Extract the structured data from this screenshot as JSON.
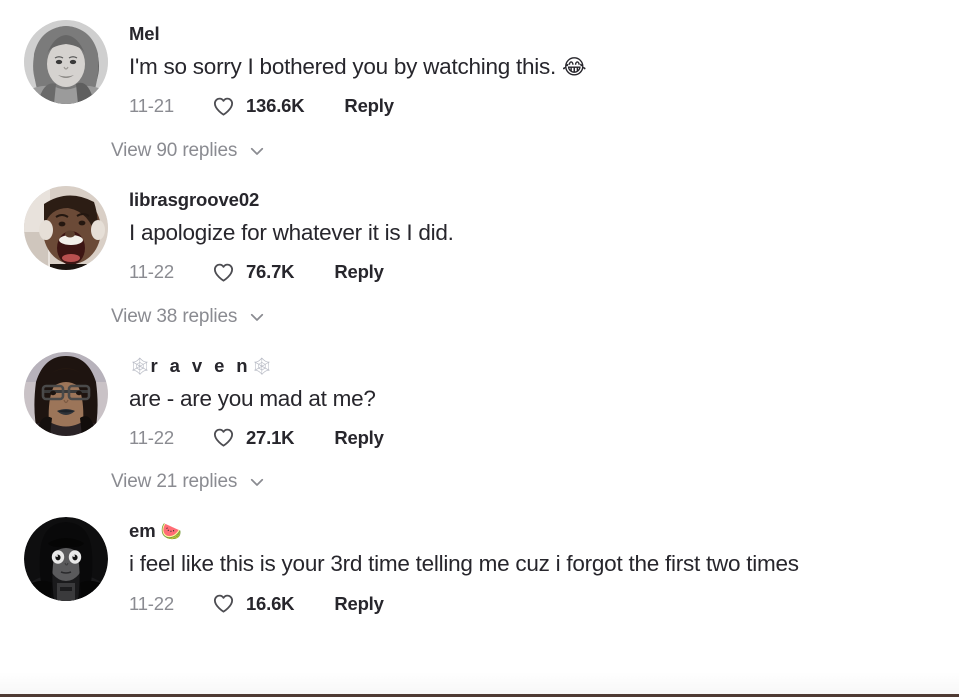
{
  "app": {
    "name": "tiktok-comments",
    "background_color": "#ffffff",
    "text_color": "#27262c",
    "muted_color": "#8a8b91",
    "border_color": "#4e3a33"
  },
  "icons": {
    "heart": "heart-outline-icon",
    "chevron": "chevron-down-icon"
  },
  "comments": [
    {
      "username": "Mel",
      "username_prefix_glyph": "",
      "username_suffix_glyph": "",
      "text": "I'm so sorry I bothered you by watching this.",
      "text_emoji": "😂",
      "date": "11-21",
      "likes": "136.6K",
      "reply_label": "Reply",
      "view_replies_label": "View 90 replies",
      "reply_count": "90",
      "avatar_alt": "grayscale-portrait-smiling-woman-long-hair"
    },
    {
      "username": "librasgroove02",
      "username_prefix_glyph": "",
      "username_suffix_glyph": "",
      "text": "I apologize for whatever it is I did.",
      "text_emoji": "",
      "date": "11-22",
      "likes": "76.7K",
      "reply_label": "Reply",
      "view_replies_label": "View 38 replies",
      "reply_count": "38",
      "avatar_alt": "color-portrait-person-mouth-open-shouting"
    },
    {
      "username": "r a v e n",
      "username_prefix_glyph": "🕸",
      "username_suffix_glyph": "🕸",
      "text": "are - are you mad at me?",
      "text_emoji": "",
      "date": "11-22",
      "likes": "27.1K",
      "reply_label": "Reply",
      "view_replies_label": "View 21 replies",
      "reply_count": "21",
      "avatar_alt": "portrait-person-glasses-dark-lipstick"
    },
    {
      "username": "em",
      "username_prefix_glyph": "",
      "username_suffix_glyph": "🍉",
      "text": "i feel like this is your 3rd time telling me cuz i forgot the first two times",
      "text_emoji": "",
      "date": "11-22",
      "likes": "16.6K",
      "reply_label": "Reply",
      "view_replies_label": "",
      "reply_count": "",
      "avatar_alt": "dark-animated-character-large-eyes-black-hair"
    }
  ]
}
